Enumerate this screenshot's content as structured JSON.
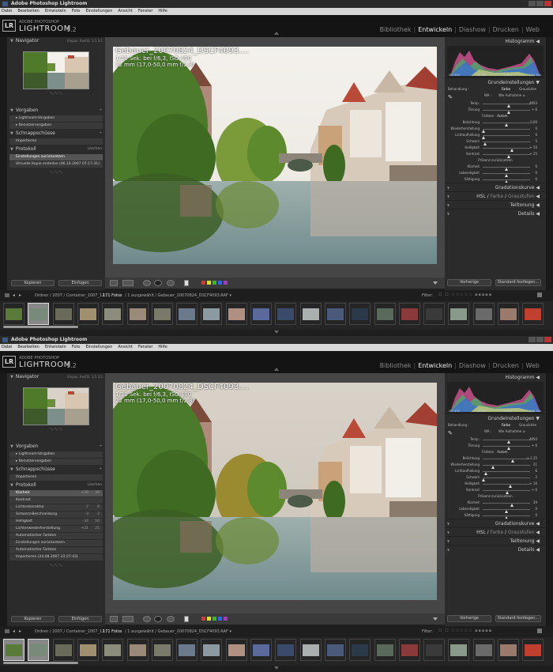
{
  "app_title": "Adobe Photoshop Lightroom",
  "menu": [
    "Datei",
    "Bearbeiten",
    "Entwickeln",
    "Foto",
    "Einstellungen",
    "Ansicht",
    "Fenster",
    "Hilfe"
  ],
  "logo": {
    "mark": "LR",
    "small": "ADOBE PHOTOSHOP",
    "big": "LIGHTROOM",
    "version": "1.2"
  },
  "modules": [
    "Bibliothek",
    "Entwickeln",
    "Diashow",
    "Drucken",
    "Web"
  ],
  "active_module": "Entwickeln",
  "left": {
    "navigator": {
      "title": "Navigator",
      "options": "Einpas.  Ausfül.  1:1  3:1"
    },
    "vorgaben": {
      "title": "Vorgaben",
      "items": [
        "Lightroom-Vorgaben",
        "Benutzervorgaben"
      ]
    },
    "schnappschuesse": {
      "title": "Schnappschüsse",
      "items": [
        "Importieren"
      ]
    },
    "protokoll": {
      "title": "Protokoll",
      "action": "Löschen"
    },
    "kopieren": "Kopieren",
    "einfuegen": "Einfügen"
  },
  "shots": [
    {
      "protokoll_items": [
        {
          "label": "Einstellungen zurücksetzen",
          "a": "",
          "b": "",
          "selected": true
        },
        {
          "label": "Virtuelle Kopie erstellen (06.10.2007 07:17:31)",
          "a": "",
          "b": "",
          "selected": false
        }
      ],
      "basic": {
        "temp": "4850",
        "toenung": "+ 6",
        "belichtung": "0,00",
        "wiederherstellung": "0",
        "lichtaufhellung": "0",
        "schwarz": "5",
        "helligkeit": "+ 50",
        "kontrast": "+ 25",
        "klarheit": "0",
        "lebendigkeit": "0",
        "saettigung": "0"
      }
    },
    {
      "protokoll_items": [
        {
          "label": "Klarheit",
          "a": "+39",
          "b": "39",
          "selected": true
        },
        {
          "label": "Kontrast",
          "a": "",
          "b": "",
          "selected": false
        },
        {
          "label": "Lichterkorrektur",
          "a": "-7",
          "b": "6",
          "selected": false
        },
        {
          "label": "Schwarz-Beschneidung",
          "a": "-3",
          "b": "2",
          "selected": false
        },
        {
          "label": "Helligkeit",
          "a": "-34",
          "b": "16",
          "selected": false
        },
        {
          "label": "Lichterwiederherstellung",
          "a": "+21",
          "b": "21",
          "selected": false
        },
        {
          "label": "Automatischer Farbton",
          "a": "",
          "b": "",
          "selected": false
        },
        {
          "label": "Einstellungen zurücksetzen",
          "a": "",
          "b": "",
          "selected": false
        },
        {
          "label": "Automatischer Farbton",
          "a": "",
          "b": "",
          "selected": false
        },
        {
          "label": "Importieren (24.08.2007 22:27:43)",
          "a": "",
          "b": "",
          "selected": false
        }
      ],
      "basic": {
        "temp": "4850",
        "toenung": "+ 6",
        "belichtung": "+ 1,35",
        "wiederherstellung": "21",
        "lichtaufhellung": "6",
        "schwarz": "2",
        "helligkeit": "+ 16",
        "kontrast": "+ 6",
        "klarheit": "39",
        "lebendigkeit": "0",
        "saettigung": "0"
      }
    }
  ],
  "photo_info": {
    "filename": "Gebauer_20070824_DSCF4093....",
    "exposure": "1/30 Sek. bei f/6,3, ISO 400",
    "lens": "22 mm (17,0-50,0 mm f/2,8)"
  },
  "right": {
    "histogramm": "Histogramm",
    "histo_info": [
      "ISO 400",
      "22 mm",
      "f / 6,3",
      "1/30 Sek."
    ],
    "grund": "Grundeinstellungen",
    "behandlung": "Behandlung :",
    "farbe": "Farbe",
    "graustufen": "Graustufen",
    "wa": "WA :",
    "wa_value": "Wie Aufnahme ≑",
    "labels": {
      "temp": "Temp.",
      "toenung": "Tönung",
      "farbton": "Farbton",
      "autom": "Autom.",
      "belichtung": "Belichtung",
      "wiederherstellung": "Wiederherstellung",
      "lichtaufhellung": "Lichtaufhellung",
      "schwarz": "Schwarz",
      "helligkeit": "Helligkeit",
      "kontrast": "Kontrast",
      "praesenz": "Präsenz zurücksetzen",
      "klarheit": "Klarheit",
      "lebendigkeit": "Lebendigkeit",
      "saettigung": "Sättigung"
    },
    "gradation": "Gradationskurve",
    "hsl": "HSL",
    "hsl_farbe": "Farbe",
    "hsl_graustufen": "Graustufen",
    "teiltonung": "Teiltonung",
    "details": "Details",
    "vorherige": "Vorherige",
    "standard": "Standard festlegen..."
  },
  "filmbar": {
    "path": "Ordner / 2007 / Container_2007_12 /",
    "count": "171 Fotos",
    "selection": "/ 1 ausgewählt / Gebauer_20070824_DSCF4093.RAF ▾",
    "filter": "Filter:"
  },
  "colors": {
    "accent": "#e0e0e0",
    "panel": "#2b2b2b",
    "bg": "#1e1e1e"
  }
}
